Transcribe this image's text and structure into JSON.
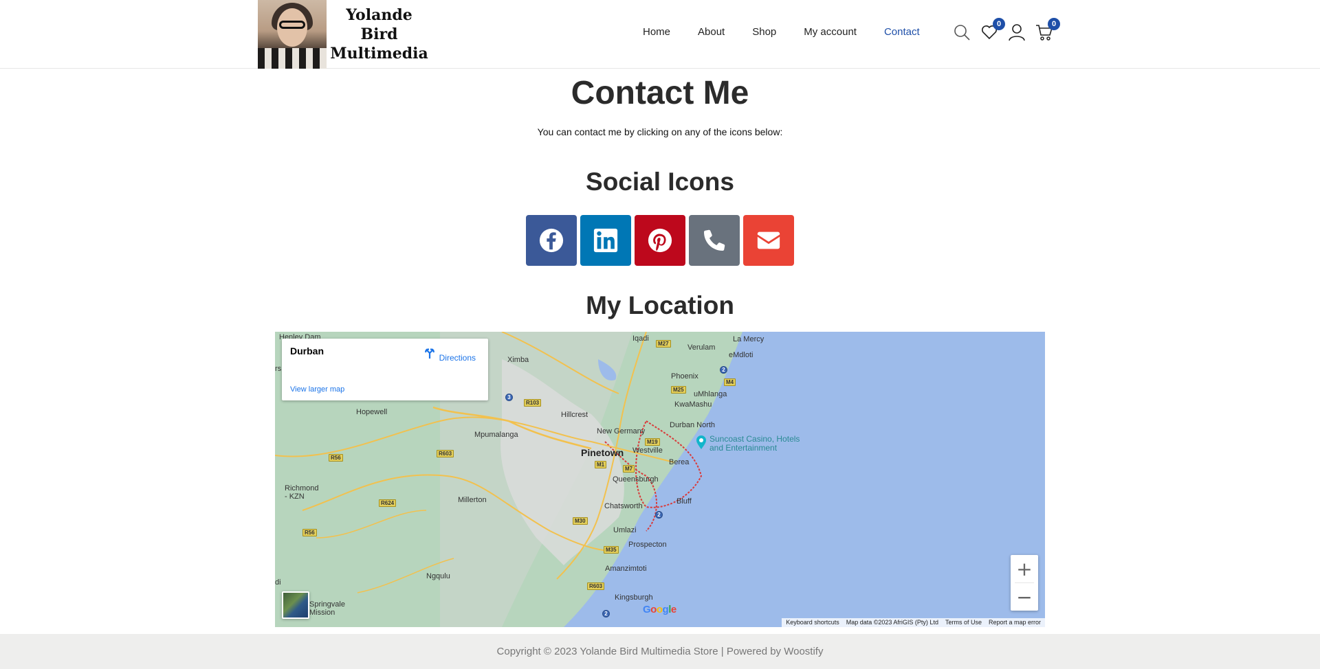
{
  "header": {
    "logo_lines": [
      "Yolande",
      "Bird",
      "Multimedia"
    ],
    "nav": [
      {
        "label": "Home",
        "active": false
      },
      {
        "label": "About",
        "active": false
      },
      {
        "label": "Shop",
        "active": false
      },
      {
        "label": "My account",
        "active": false
      },
      {
        "label": "Contact",
        "active": true
      }
    ],
    "icons": {
      "search": "search-icon",
      "wishlist": "heart-icon",
      "account": "user-icon",
      "cart": "cart-icon"
    },
    "wishlist_count": "0",
    "cart_count": "0",
    "accent_color": "#1e4fa8"
  },
  "main": {
    "title": "Contact Me",
    "intro": "You can contact me by clicking on any of the icons below:",
    "social_heading": "Social Icons",
    "social_icons": [
      {
        "name": "facebook-icon",
        "color": "#3b5998"
      },
      {
        "name": "linkedin-icon",
        "color": "#0077b5"
      },
      {
        "name": "pinterest-icon",
        "color": "#bd081c"
      },
      {
        "name": "phone-icon",
        "color": "#69727d"
      },
      {
        "name": "envelope-icon",
        "color": "#ea4335"
      }
    ],
    "location_heading": "My Location"
  },
  "map": {
    "place": "Durban",
    "directions_label": "Directions",
    "view_larger": "View larger map",
    "labels": {
      "henley_dam": "Henley Dam",
      "iqadi": "Iqadi",
      "verulam": "Verulam",
      "la_mercy": "La Mercy",
      "emdloti": "eMdloti",
      "ximba": "Ximba",
      "phoenix": "Phoenix",
      "umhlanga": "uMhlanga",
      "kwamashu": "KwaMashu",
      "hopewell": "Hopewell",
      "hillcrest": "Hillcrest",
      "mpumalanga": "Mpumalanga",
      "new_germany": "New Germany",
      "durban_north": "Durban North",
      "pinetown": "Pinetown",
      "westville": "Westville",
      "berea": "Berea",
      "queensburgh": "Queensburgh",
      "richmond": "Richmond\n- KZN",
      "millerton": "Millerton",
      "chatsworth": "Chatsworth",
      "bluff": "Bluff",
      "umlazi": "Umlazi",
      "prospecton": "Prospecton",
      "amanzimtoti": "Amanzimtoti",
      "ngqulu": "Ngqulu",
      "kingsburgh": "Kingsburgh",
      "springvale": "Springvale\nMission",
      "casino": "Suncoast Casino, Hotels\nand Entertainment",
      "rs": "rs",
      "di": "di"
    },
    "routes": [
      "M27",
      "2",
      "M4",
      "M25",
      "3",
      "R103",
      "M19",
      "M1",
      "M7",
      "R603",
      "R56",
      "R624",
      "R56",
      "M30",
      "M35",
      "R603",
      "2",
      "2"
    ],
    "google_logo": "Google",
    "attribution": [
      "Keyboard shortcuts",
      "Map data ©2023 AfriGIS (Pty) Ltd",
      "Terms of Use",
      "Report a map error"
    ],
    "zoom_in": "+",
    "zoom_out": "−",
    "land_color": "#b7d5bd",
    "sea_color": "#9dbbea"
  },
  "footer": {
    "text": "Copyright © 2023 Yolande Bird Multimedia Store | Powered by Woostify"
  }
}
